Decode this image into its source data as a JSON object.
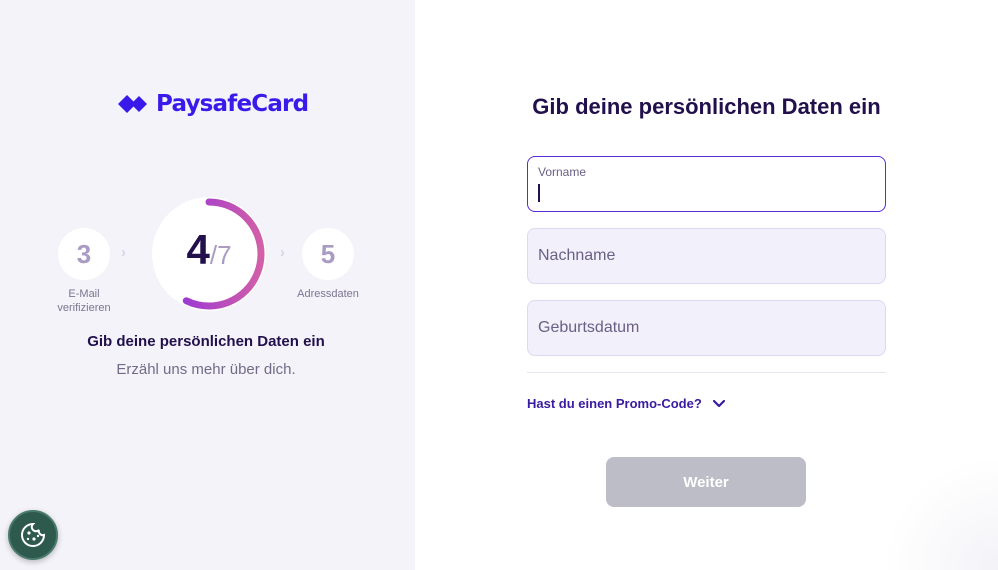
{
  "brand": {
    "name": "PaysafeCard",
    "color": "#3a1aea"
  },
  "stepper": {
    "previous": {
      "number": "3",
      "label_line1": "E-Mail",
      "label_line2": "verifizieren"
    },
    "current": "4",
    "total": "7",
    "separator": "/",
    "next": {
      "number": "5",
      "label": "Adressdaten"
    },
    "progress_fraction": 0.5714,
    "title": "Gib deine persönlichen Daten ein",
    "subtitle": "Erzähl uns mehr über dich."
  },
  "form": {
    "title": "Gib deine persönlichen Daten ein",
    "fields": {
      "vorname": {
        "label": "Vorname",
        "value": ""
      },
      "nachname": {
        "placeholder": "Nachname"
      },
      "geburtsdatum": {
        "placeholder": "Geburtsdatum"
      }
    },
    "promo_label": "Hast du einen Promo-Code?",
    "submit_label": "Weiter"
  },
  "colors": {
    "accent": "#5b2bd6",
    "dark_text": "#22104c",
    "button_disabled": "#bdbdc8",
    "cookie_button": "#2d5a4c"
  },
  "icons": {
    "logo": "paysafecard-diamond-icon",
    "promo_toggle": "chevron-down-icon",
    "cookie": "cookie-icon"
  }
}
